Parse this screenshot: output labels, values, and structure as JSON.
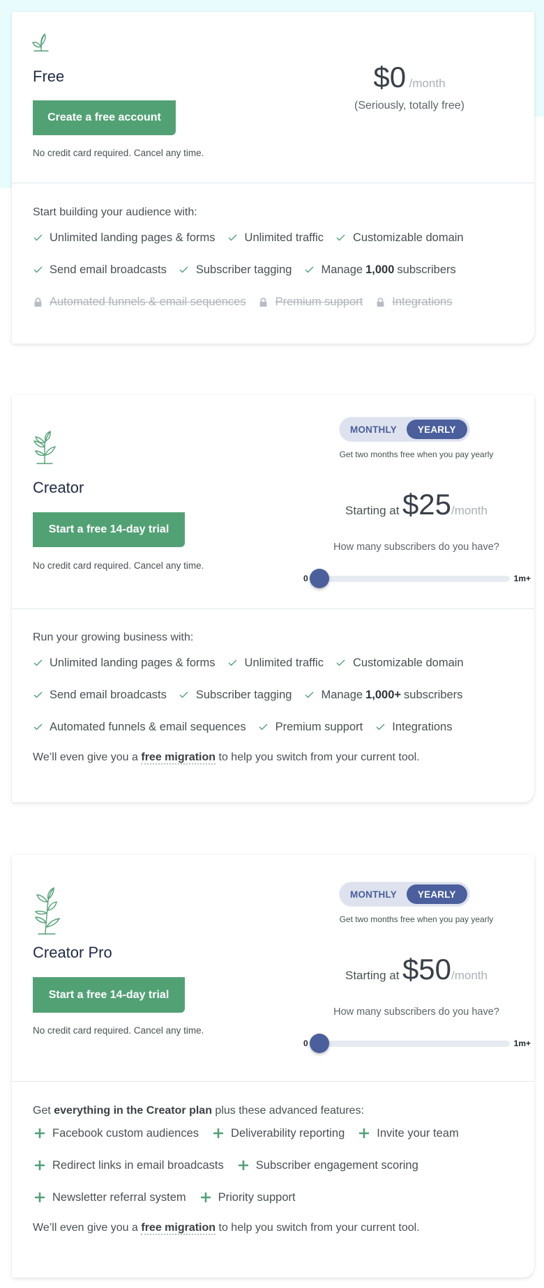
{
  "colors": {
    "brand_green": "#52a175",
    "toggle_blue": "#4a5f9c",
    "heading": "#1f2a44",
    "background_wash": "#e8fcfd"
  },
  "plans": [
    {
      "icon": "sprout-icon",
      "name": "Free",
      "cta_label": "Create a free account",
      "note": "No credit card required. Cancel any time.",
      "price": "$0",
      "per": "/month",
      "price_note": "(Seriously, totally free)",
      "lead": "Start building your audience with:",
      "features": [
        {
          "icon": "check-icon",
          "text": "Unlimited landing pages & forms",
          "available": true
        },
        {
          "icon": "check-icon",
          "text": "Unlimited traffic",
          "available": true
        },
        {
          "icon": "check-icon",
          "text": "Customizable domain",
          "available": true
        },
        {
          "icon": "check-icon",
          "text": "Send email broadcasts",
          "available": true
        },
        {
          "icon": "check-icon",
          "text": "Subscriber tagging",
          "available": true
        },
        {
          "icon": "check-icon",
          "pre": "Manage",
          "bold": "1,000",
          "post": "subscribers",
          "available": true
        },
        {
          "icon": "lock-icon",
          "text": "Automated funnels & email sequences",
          "available": false
        },
        {
          "icon": "lock-icon",
          "text": "Premium support",
          "available": false
        },
        {
          "icon": "lock-icon",
          "text": "Integrations",
          "available": false
        }
      ]
    },
    {
      "icon": "plant-icon",
      "name": "Creator",
      "cta_label": "Start a free 14-day trial",
      "note": "No credit card required. Cancel any time.",
      "billing_toggle": {
        "options": [
          "MONTHLY",
          "YEARLY"
        ],
        "selected": "YEARLY"
      },
      "toggle_note": "Get two months free when you pay yearly",
      "starting_label": "Starting at",
      "price": "$25",
      "per": "/month",
      "question": "How many subscribers do you have?",
      "slider": {
        "min_label": "0",
        "max_label": "1m+",
        "value_fraction": 0.0
      },
      "lead": "Run your growing business with:",
      "features": [
        {
          "icon": "check-icon",
          "text": "Unlimited landing pages & forms",
          "available": true
        },
        {
          "icon": "check-icon",
          "text": "Unlimited traffic",
          "available": true
        },
        {
          "icon": "check-icon",
          "text": "Customizable domain",
          "available": true
        },
        {
          "icon": "check-icon",
          "text": "Send email broadcasts",
          "available": true
        },
        {
          "icon": "check-icon",
          "text": "Subscriber tagging",
          "available": true
        },
        {
          "icon": "check-icon",
          "pre": "Manage",
          "bold": "1,000+",
          "post": "subscribers",
          "available": true
        },
        {
          "icon": "check-icon",
          "text": "Automated funnels & email sequences",
          "available": true
        },
        {
          "icon": "check-icon",
          "text": "Premium support",
          "available": true
        },
        {
          "icon": "check-icon",
          "text": "Integrations",
          "available": true
        }
      ],
      "migration": {
        "pre": "We’ll even give you a",
        "link": "free migration",
        "post": "to help you switch from your current tool."
      }
    },
    {
      "icon": "tall-plant-icon",
      "name": "Creator Pro",
      "cta_label": "Start a free 14-day trial",
      "note": "No credit card required. Cancel any time.",
      "billing_toggle": {
        "options": [
          "MONTHLY",
          "YEARLY"
        ],
        "selected": "YEARLY"
      },
      "toggle_note": "Get two months free when you pay yearly",
      "starting_label": "Starting at",
      "price": "$50",
      "per": "/month",
      "question": "How many subscribers do you have?",
      "slider": {
        "min_label": "0",
        "max_label": "1m+",
        "value_fraction": 0.0
      },
      "lead_pre": "Get",
      "lead_bold": "everything in the Creator plan",
      "lead_post": "plus these advanced features:",
      "features": [
        {
          "icon": "plus-icon",
          "text": "Facebook custom audiences"
        },
        {
          "icon": "plus-icon",
          "text": "Deliverability reporting"
        },
        {
          "icon": "plus-icon",
          "text": "Invite your team"
        },
        {
          "icon": "plus-icon",
          "text": "Redirect links in email broadcasts"
        },
        {
          "icon": "plus-icon",
          "text": "Subscriber engagement scoring"
        },
        {
          "icon": "plus-icon",
          "text": "Newsletter referral system"
        },
        {
          "icon": "plus-icon",
          "text": "Priority support"
        }
      ],
      "migration": {
        "pre": "We’ll even give you a",
        "link": "free migration",
        "post": "to help you switch from your current tool."
      }
    }
  ]
}
